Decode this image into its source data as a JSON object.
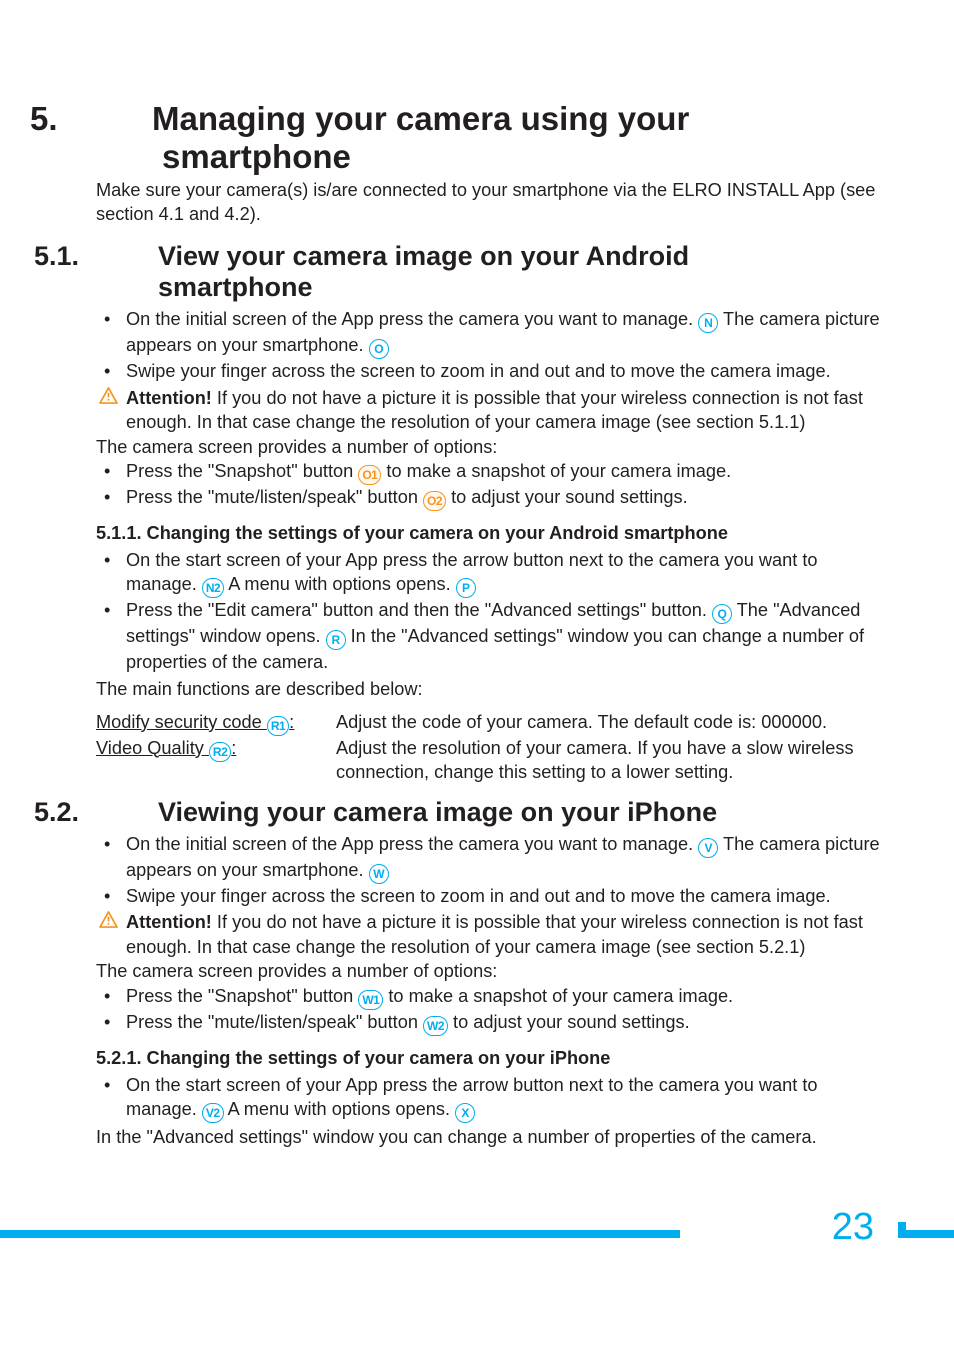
{
  "chapter": {
    "number": "5.",
    "titleA": "Managing your camera using your",
    "titleB": "smartphone",
    "intro": "Make sure your camera(s) is/are connected to your smartphone via the ELRO INSTALL App (see section 4.1 and 4.2)."
  },
  "s51": {
    "number": "5.1.",
    "titleA": "View your camera image on your Android",
    "titleB": "smartphone",
    "b1a": "On the initial screen of the App press the camera you want to manage. ",
    "b1b": " The camera picture appears on your smartphone. ",
    "b2": "Swipe your finger across the screen to zoom in and out and to move the camera image.",
    "attnWord": "Attention!",
    "attnRest": " If you do not have a picture it is possible that your wireless connection is not fast enough. In that case change the resolution of your camera image (see section 5.1.1)",
    "opts": "The camera screen provides a number of options:",
    "b3a": "Press the \"Snapshot\" button ",
    "b3b": " to make a snapshot of your camera image.",
    "b4a": "Press the \"mute/listen/speak\" button ",
    "b4b": " to adjust your sound settings."
  },
  "s511": {
    "title": "5.1.1.  Changing the settings of your camera on your Android smartphone",
    "b1a": "On the start screen of your App press the arrow button next to the camera you want to manage. ",
    "b1b": " A menu with options opens. ",
    "b2a": "Press the \"Edit camera\" button and then the \"Advanced settings\" button. ",
    "b2b": " The \"Advanced settings\" window opens. ",
    "b2c": " In the \"Advanced settings\" window you can change a number of properties of the camera.",
    "mainf": "The main functions are described below:",
    "term1a": "Modify security code ",
    "term1b": ":",
    "def1": "Adjust the code of your camera. The default code is: 000000.",
    "term2a": "Video Quality ",
    "term2b": ":",
    "def2": "Adjust the resolution of your camera. If you have a slow wireless connection, change this setting to a lower setting."
  },
  "s52": {
    "number": "5.2.",
    "title": "Viewing your camera image on your iPhone",
    "b1a": "On the initial screen of the App press the camera you want to manage. ",
    "b1b": " The camera picture appears on your smartphone. ",
    "b2": "Swipe your finger across the screen to zoom in and out and to move the camera image.",
    "attnWord": "Attention!",
    "attnRest": " If you do not have a picture it is possible that your wireless connection is not fast enough. In that case change the resolution of your camera image (see section 5.2.1)",
    "opts": "The camera screen provides a number of options:",
    "b3a": "Press the \"Snapshot\" button ",
    "b3b": " to make a snapshot of your camera image.",
    "b4a": "Press the \"mute/listen/speak\" button ",
    "b4b": " to adjust your sound settings."
  },
  "s521": {
    "title": "5.2.1.  Changing the settings of your camera on your iPhone",
    "b1a": "On the start screen of your App press the arrow button next to the camera you want to manage. ",
    "b1b": " A menu with options opens. ",
    "inadv": "In the \"Advanced settings\" window you can change a number of properties of the camera."
  },
  "circ": {
    "N": "N",
    "O": "O",
    "O1": "O1",
    "O2": "O2",
    "N2": "N2",
    "P": "P",
    "Q": "Q",
    "R": "R",
    "R1": "R1",
    "R2": "R2",
    "V": "V",
    "W": "W",
    "W1": "W1",
    "W2": "W2",
    "V2": "V2",
    "X": "X"
  },
  "pagenum": "23"
}
